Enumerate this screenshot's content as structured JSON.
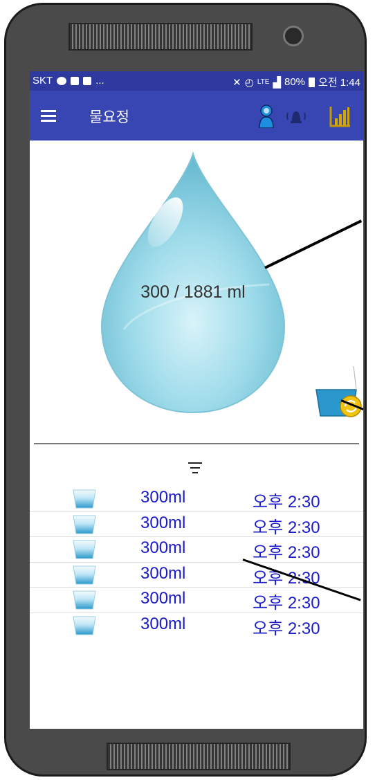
{
  "status_bar": {
    "carrier": "SKT",
    "ellipsis": "...",
    "network": "LTE",
    "battery": "80%",
    "time": "오전 1:44"
  },
  "app_bar": {
    "title": "물요정",
    "icons": [
      "menu-icon",
      "user-icon",
      "bell-icon",
      "stats-icon"
    ]
  },
  "progress": {
    "label": "300 / 1881 ml",
    "current_ml": 300,
    "goal_ml": 1881
  },
  "colors": {
    "app_bar": "#3746b2",
    "status_bar": "#2f3aa0",
    "drop": "#8fd3e3",
    "list_text": "#1a1ac8",
    "cup_water": "#2a98cc"
  },
  "log": {
    "sort_icon": "sort-icon",
    "entries": [
      {
        "amount": "300ml",
        "time": "오후 2:30"
      },
      {
        "amount": "300ml",
        "time": "오후 2:30"
      },
      {
        "amount": "300ml",
        "time": "오후 2:30"
      },
      {
        "amount": "300ml",
        "time": "오후 2:30"
      },
      {
        "amount": "300ml",
        "time": "오후 2:30"
      },
      {
        "amount": "300ml",
        "time": "오후 2:30"
      }
    ]
  }
}
